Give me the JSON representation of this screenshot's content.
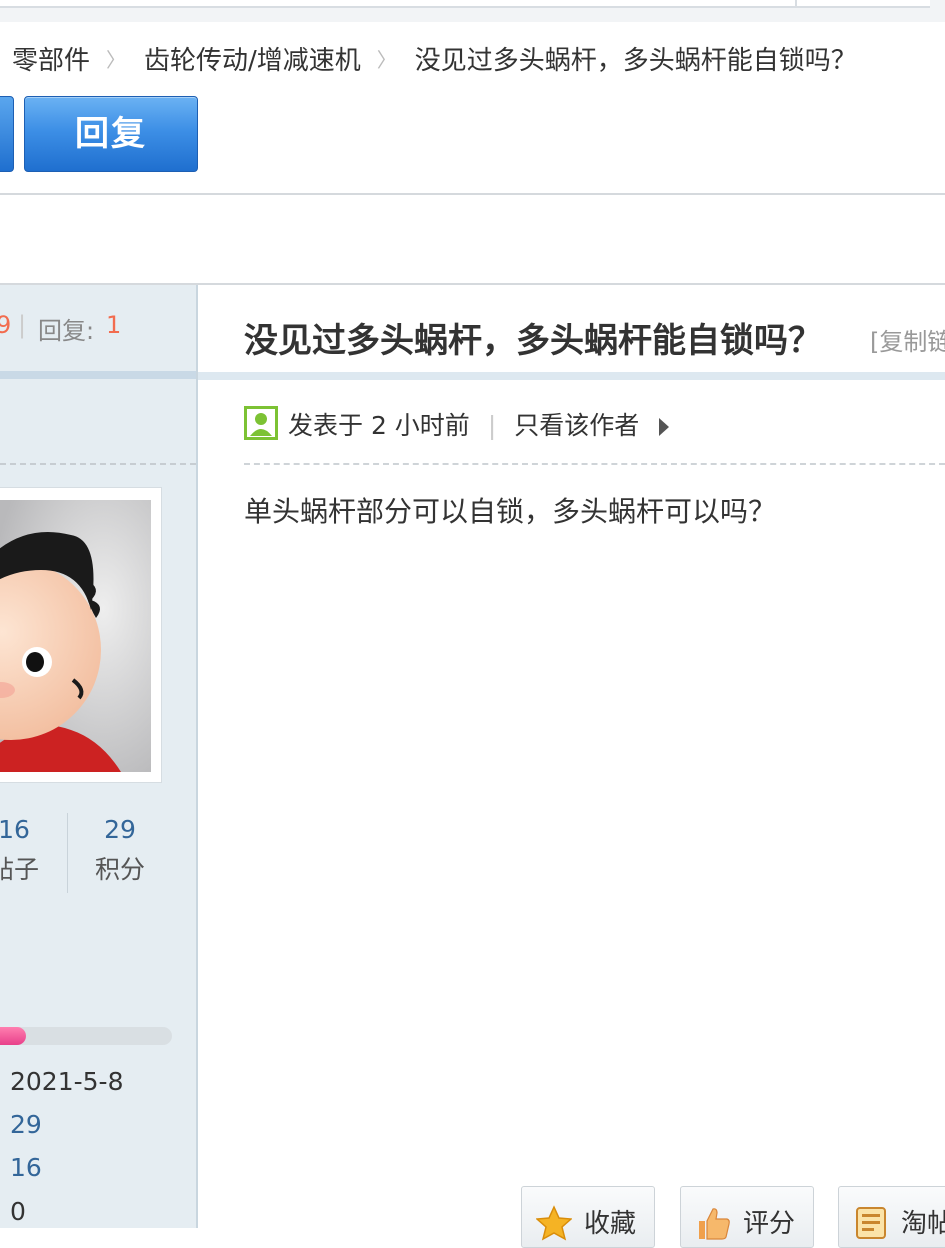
{
  "breadcrumb": [
    "零部件",
    "齿轮传动/增减速机",
    "没见过多头蜗杆，多头蜗杆能自锁吗？"
  ],
  "breadcrumb_separator": "〉",
  "reply_button": "回复",
  "sidebar": {
    "stats_partial_value": "9",
    "stats_pipe": "|",
    "reply_label": "回复:",
    "reply_count": "1",
    "author_stats": [
      {
        "value": "16",
        "label": "帖子"
      },
      {
        "value": "29",
        "label": "积分"
      }
    ],
    "level_progress_fraction": 0.2,
    "info": [
      "2021-5-8",
      "29",
      "16",
      "0"
    ]
  },
  "post": {
    "title": "没见过多头蜗杆，多头蜗杆能自锁吗？",
    "copy_link": "[复制链接]",
    "posted": "发表于 2 小时前",
    "only_author": "只看该作者",
    "body": "单头蜗杆部分可以自锁，多头蜗杆可以吗？"
  },
  "actions": [
    {
      "label": "收藏",
      "icon": "star-icon"
    },
    {
      "label": "评分",
      "icon": "thumbs-up-icon"
    },
    {
      "label": "淘帖",
      "icon": "collection-icon"
    }
  ],
  "colors": {
    "accent_blue": "#2a7ad8",
    "highlight_red": "#f26c4f",
    "link_blue": "#336699",
    "progress_pink": "#e8408a"
  }
}
